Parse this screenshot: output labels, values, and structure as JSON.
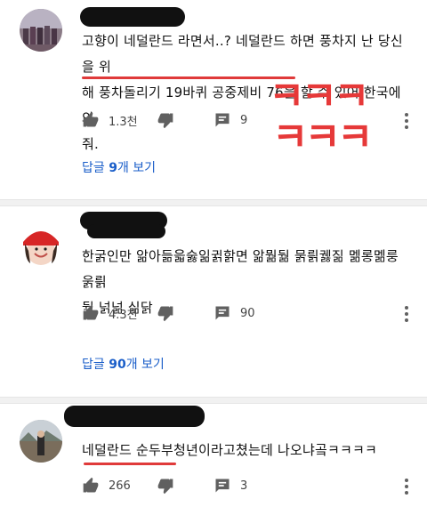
{
  "comments": [
    {
      "text_line1": "고향이 네덜란드 라면서..? 네덜란드 하면 풍차지 난 당신을 위",
      "text_line2": "해 풍차돌리기 19바퀴 공중제비 76을 할 수 있어 한국에 와",
      "text_line3": "줘.",
      "likes": "1.3천",
      "replies_count": "9",
      "reply_prefix": "답글 ",
      "reply_num": "9",
      "reply_suffix": "개 보기",
      "handwriting_line1": "ㅋㅋㅋ",
      "handwriting_line2": "ㅋㅋㅋ"
    },
    {
      "text_line1": "한굵인만 앎아듦읇숧읾귉핡면 앎뭚둶 묽릙궳짊 멞롱멞룽 욹릙",
      "text_line2": "둶 넑넒 싦닭",
      "likes": "4.3천",
      "replies_count": "90",
      "reply_prefix": "답글 ",
      "reply_num": "90",
      "reply_suffix": "개 보기"
    },
    {
      "text_line1": "네덜란드 순두부청년이라고쳤는데 나오냐곸ㅋㅋㅋㅋ",
      "likes": "266",
      "replies_count": "3"
    }
  ],
  "colors": {
    "link": "#1a5ec9",
    "annotation_red": "#e63939",
    "icon_gray": "#606060"
  },
  "icons": [
    "thumb-up-icon",
    "thumb-down-icon",
    "comment-icon",
    "more-vert-icon"
  ]
}
